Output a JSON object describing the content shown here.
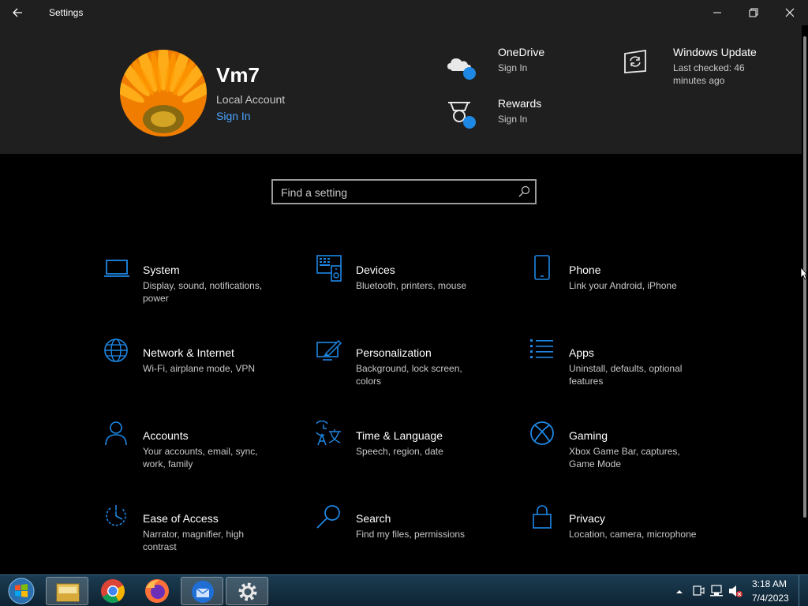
{
  "window": {
    "title": "Settings"
  },
  "user": {
    "name": "Vm7",
    "account_type": "Local Account",
    "sign_in": "Sign In"
  },
  "header_items": {
    "onedrive": {
      "title": "OneDrive",
      "sub": "Sign In",
      "icon": "onedrive-cloud-icon"
    },
    "rewards": {
      "title": "Rewards",
      "sub": "Sign In",
      "icon": "rewards-trophy-icon"
    },
    "update": {
      "title": "Windows Update",
      "sub": "Last checked: 46 minutes ago",
      "icon": "windows-update-icon"
    }
  },
  "search": {
    "placeholder": "Find a setting"
  },
  "tiles": [
    {
      "title": "System",
      "desc": "Display, sound, notifications, power",
      "icon": "laptop-icon"
    },
    {
      "title": "Devices",
      "desc": "Bluetooth, printers, mouse",
      "icon": "devices-icon"
    },
    {
      "title": "Phone",
      "desc": "Link your Android, iPhone",
      "icon": "phone-icon"
    },
    {
      "title": "Network & Internet",
      "desc": "Wi-Fi, airplane mode, VPN",
      "icon": "globe-icon"
    },
    {
      "title": "Personalization",
      "desc": "Background, lock screen, colors",
      "icon": "paintbrush-icon"
    },
    {
      "title": "Apps",
      "desc": "Uninstall, defaults, optional features",
      "icon": "apps-list-icon"
    },
    {
      "title": "Accounts",
      "desc": "Your accounts, email, sync, work, family",
      "icon": "person-icon"
    },
    {
      "title": "Time & Language",
      "desc": "Speech, region, date",
      "icon": "time-language-icon"
    },
    {
      "title": "Gaming",
      "desc": "Xbox Game Bar, captures, Game Mode",
      "icon": "xbox-icon"
    },
    {
      "title": "Ease of Access",
      "desc": "Narrator, magnifier, high contrast",
      "icon": "ease-of-access-icon"
    },
    {
      "title": "Search",
      "desc": "Find my files, permissions",
      "icon": "search-icon"
    },
    {
      "title": "Privacy",
      "desc": "Location, camera, microphone",
      "icon": "lock-icon"
    }
  ],
  "taskbar": {
    "apps": [
      "start-orb-icon",
      "file-explorer-icon",
      "chrome-icon",
      "firefox-icon",
      "thunderbird-icon",
      "settings-gear-icon"
    ],
    "clock_time": "3:18 AM",
    "clock_date": "7/4/2023"
  },
  "colors": {
    "accent": "#1e88e5",
    "link": "#4aa3ff",
    "header_bg": "#1f1f1f",
    "body_bg": "#000000"
  }
}
